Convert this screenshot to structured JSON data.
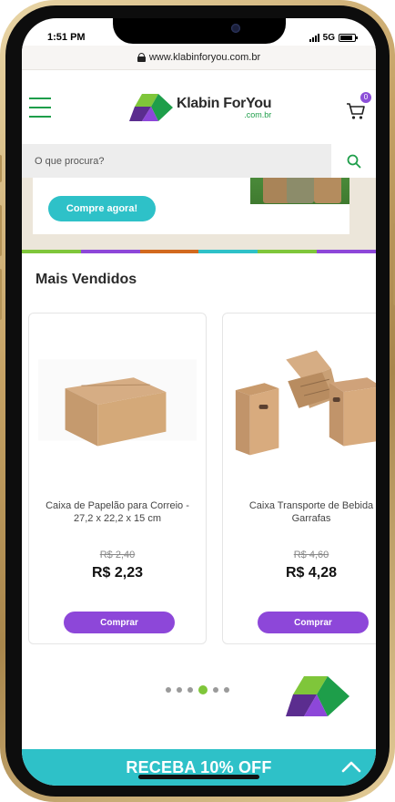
{
  "status_bar": {
    "time": "1:51 PM",
    "network": "5G"
  },
  "browser": {
    "url": "www.klabinforyou.com.br"
  },
  "header": {
    "logo_main": "Klabin ForYou",
    "logo_sub": ".com.br",
    "cart_count": "0"
  },
  "search": {
    "placeholder": "O que procura?"
  },
  "banner": {
    "cta_label": "Compre agora!"
  },
  "section": {
    "title": "Mais Vendidos"
  },
  "products": [
    {
      "name": "Caixa de Papelão para Correio - 27,2 x 22,2 x 15 cm",
      "old_price": "R$ 2,40",
      "price": "R$ 2,23",
      "button_label": "Comprar"
    },
    {
      "name": "Caixa Transporte de Bebida Garrafas",
      "old_price": "R$ 4,60",
      "price": "R$ 4,28",
      "button_label": "Comprar"
    }
  ],
  "carousel": {
    "dot_count": 6,
    "active_dot": 4
  },
  "promo_bar": {
    "label": "RECEBA 10% OFF"
  },
  "colors": {
    "brand_green": "#1e9e4a",
    "brand_purple": "#8d47d9",
    "brand_teal": "#2ec1c8",
    "stripe": [
      "#7fc63a",
      "#8d47d9",
      "#d2691e",
      "#2ec1c8",
      "#7fc63a",
      "#8d47d9"
    ]
  }
}
